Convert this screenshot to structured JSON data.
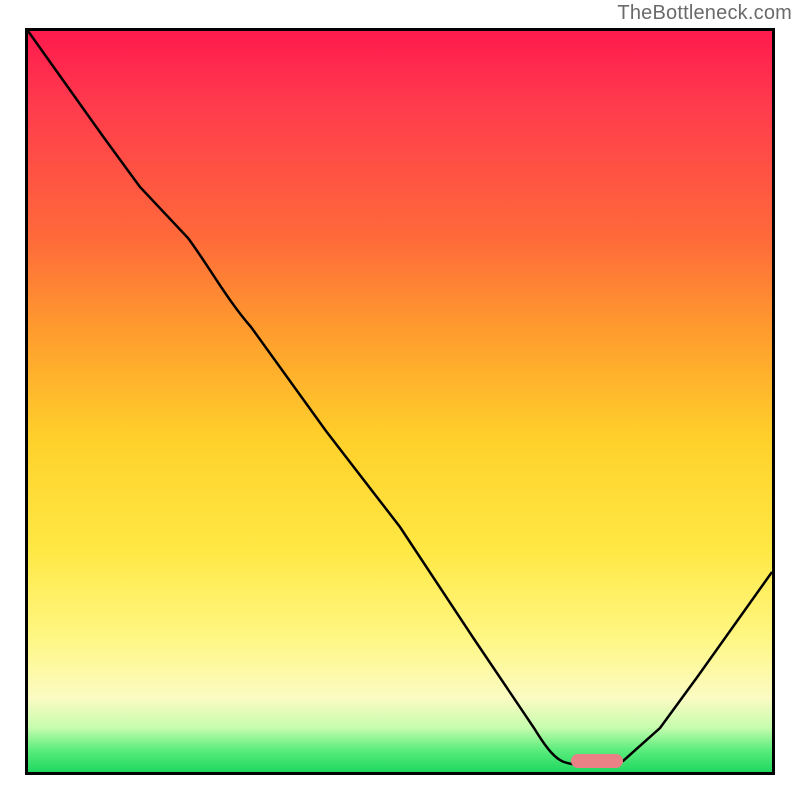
{
  "attribution": "TheBottleneck.com",
  "colors": {
    "border": "#000000",
    "attribution_text": "#6a6a6a",
    "curve": "#000000",
    "marker_fill": "#e98186",
    "gradient": [
      {
        "stop": 0,
        "hex": "#ff1a4d"
      },
      {
        "stop": 10,
        "hex": "#ff3b4d"
      },
      {
        "stop": 28,
        "hex": "#ff6a3a"
      },
      {
        "stop": 40,
        "hex": "#ff9a2e"
      },
      {
        "stop": 55,
        "hex": "#ffd02a"
      },
      {
        "stop": 70,
        "hex": "#ffe844"
      },
      {
        "stop": 82,
        "hex": "#fff784"
      },
      {
        "stop": 90,
        "hex": "#fbfbc3"
      },
      {
        "stop": 94,
        "hex": "#c7fcae"
      },
      {
        "stop": 97,
        "hex": "#5ced7d"
      },
      {
        "stop": 100,
        "hex": "#1ed85f"
      }
    ]
  },
  "chart_data": {
    "type": "line",
    "title": "",
    "xlabel": "",
    "ylabel": "",
    "ylim": [
      0,
      100
    ],
    "xlim": [
      0,
      100
    ],
    "series": [
      {
        "name": "curve",
        "x": [
          0,
          5,
          10,
          15,
          21.5,
          30,
          40,
          50,
          60,
          68,
          72,
          76,
          80,
          85,
          90,
          95,
          100
        ],
        "values": [
          100,
          93,
          86,
          79,
          72,
          60,
          46,
          33,
          18,
          6,
          2,
          1,
          2,
          6,
          13,
          20,
          27
        ]
      }
    ],
    "marker": {
      "name": "optimal-range",
      "shape": "stadium",
      "x_start": 73,
      "x_end": 80,
      "y": 1
    }
  }
}
